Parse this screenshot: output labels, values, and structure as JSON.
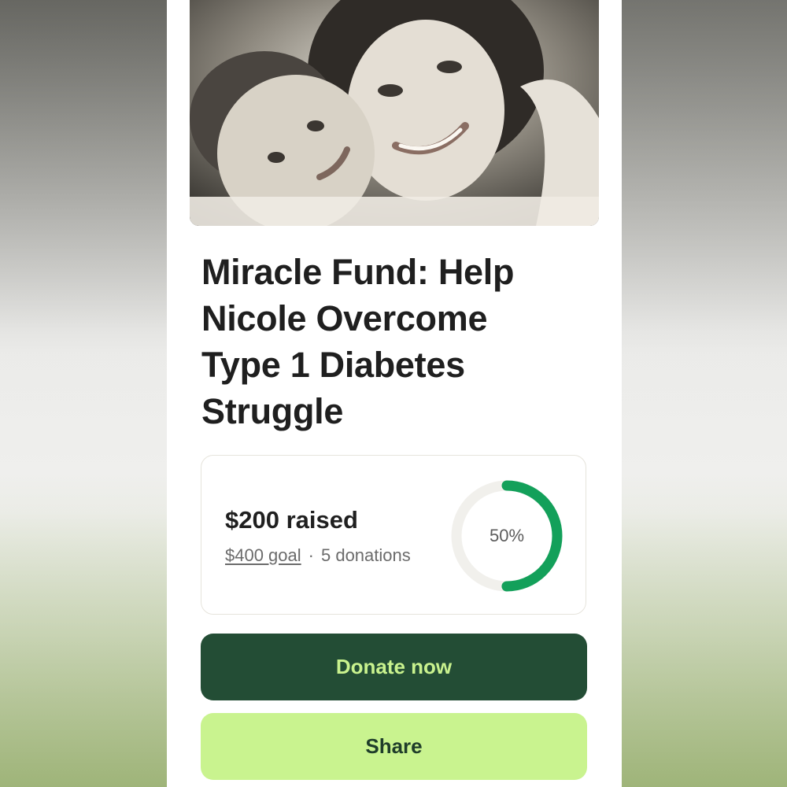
{
  "campaign": {
    "title": "Miracle Fund: Help Nicole Overcome Type 1 Diabetes Struggle",
    "hero_image": "photo-of-woman-hugging-child"
  },
  "progress": {
    "raised_text": "$200 raised",
    "goal_text": "$400 goal",
    "separator": "·",
    "donations_text": "5 donations",
    "percent_text": "50%",
    "fraction": 0.5
  },
  "actions": {
    "donate_label": "Donate now",
    "share_label": "Share"
  },
  "colors": {
    "ring_progress": "#13a05a",
    "ring_track": "#f1f0ec",
    "donate_bg": "#234d35",
    "donate_text": "#c9f28e",
    "share_bg": "#c9f38f",
    "share_text": "#1f3d2a"
  }
}
